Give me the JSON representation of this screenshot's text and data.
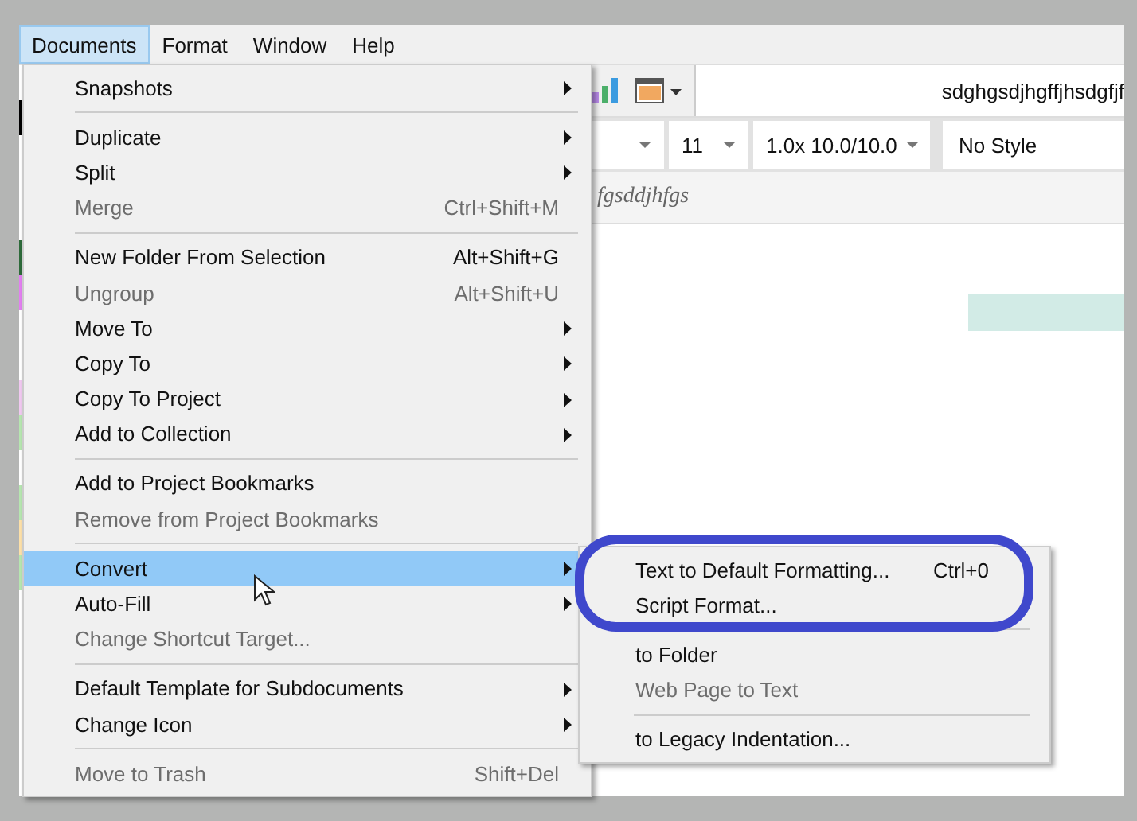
{
  "menubar": [
    {
      "label": "Documents",
      "selected": true
    },
    {
      "label": "Format",
      "selected": false
    },
    {
      "label": "Window",
      "selected": false
    },
    {
      "label": "Help",
      "selected": false
    }
  ],
  "toolbar": {
    "title_field": "sdghgsdjhgffjhsdgfjf",
    "font_size": "11",
    "spacing": "1.0x 10.0/10.0",
    "style": "No Style"
  },
  "editor": {
    "text_fragment": "fgsddjhfgs"
  },
  "menu": [
    {
      "kind": "item",
      "label": "Snapshots",
      "submenu": true,
      "disabled": false,
      "selected": false
    },
    {
      "kind": "separator"
    },
    {
      "kind": "item",
      "label": "Duplicate",
      "submenu": true,
      "disabled": false,
      "selected": false
    },
    {
      "kind": "item",
      "label": "Split",
      "submenu": true,
      "disabled": false,
      "selected": false
    },
    {
      "kind": "item",
      "label": "Merge",
      "shortcut": "Ctrl+Shift+M",
      "submenu": false,
      "disabled": true,
      "selected": false
    },
    {
      "kind": "separator"
    },
    {
      "kind": "item",
      "label": "New Folder From Selection",
      "shortcut": "Alt+Shift+G",
      "submenu": false,
      "disabled": false,
      "selected": false
    },
    {
      "kind": "item",
      "label": "Ungroup",
      "shortcut": "Alt+Shift+U",
      "submenu": false,
      "disabled": true,
      "selected": false
    },
    {
      "kind": "item",
      "label": "Move To",
      "submenu": true,
      "disabled": false,
      "selected": false
    },
    {
      "kind": "item",
      "label": "Copy To",
      "submenu": true,
      "disabled": false,
      "selected": false
    },
    {
      "kind": "item",
      "label": "Copy To Project",
      "submenu": true,
      "disabled": false,
      "selected": false
    },
    {
      "kind": "item",
      "label": "Add to Collection",
      "submenu": true,
      "disabled": false,
      "selected": false
    },
    {
      "kind": "separator"
    },
    {
      "kind": "item",
      "label": "Add to Project Bookmarks",
      "submenu": false,
      "disabled": false,
      "selected": false
    },
    {
      "kind": "item",
      "label": "Remove from Project Bookmarks",
      "submenu": false,
      "disabled": true,
      "selected": false
    },
    {
      "kind": "separator"
    },
    {
      "kind": "item",
      "label": "Convert",
      "submenu": true,
      "disabled": false,
      "selected": true
    },
    {
      "kind": "item",
      "label": "Auto-Fill",
      "submenu": true,
      "disabled": false,
      "selected": false
    },
    {
      "kind": "item",
      "label": "Change Shortcut Target...",
      "submenu": false,
      "disabled": true,
      "selected": false
    },
    {
      "kind": "separator"
    },
    {
      "kind": "item",
      "label": "Default Template for Subdocuments",
      "submenu": true,
      "disabled": false,
      "selected": false
    },
    {
      "kind": "item",
      "label": "Change Icon",
      "submenu": true,
      "disabled": false,
      "selected": false
    },
    {
      "kind": "separator"
    },
    {
      "kind": "item",
      "label": "Move to Trash",
      "shortcut": "Shift+Del",
      "submenu": false,
      "disabled": true,
      "selected": false
    }
  ],
  "submenu": [
    {
      "kind": "item",
      "label": "Text to Default Formatting...",
      "shortcut": "Ctrl+0",
      "disabled": false,
      "highlighted": true
    },
    {
      "kind": "item",
      "label": "Script Format...",
      "disabled": false,
      "highlighted": true
    },
    {
      "kind": "separator"
    },
    {
      "kind": "item",
      "label": "to Folder",
      "disabled": false,
      "highlighted": false
    },
    {
      "kind": "item",
      "label": "Web Page to Text",
      "disabled": true,
      "highlighted": false
    },
    {
      "kind": "separator"
    },
    {
      "kind": "item",
      "label": "to Legacy Indentation...",
      "disabled": false,
      "highlighted": false
    }
  ]
}
